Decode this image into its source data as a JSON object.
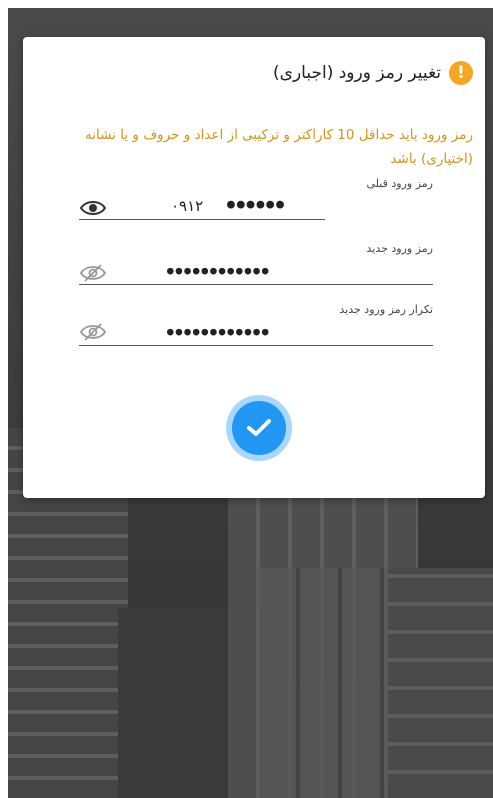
{
  "dialog": {
    "title": "تغییر رمز ورود  (اجباری)",
    "hint": "رمز ورود باید حداقل 10 کاراکتر و ترکیبی از اعداد و حروف و یا نشانه (اختیاری) باشد"
  },
  "fields": {
    "old_password": {
      "label": "رمز ورود قبلی",
      "prefix": "۰۹۱۲",
      "value": "●●●●●●"
    },
    "new_password": {
      "label": "رمز ورود جدید",
      "value": "●●●●●●●●●●●●"
    },
    "confirm_password": {
      "label": "تکرار رمز ورود جدید",
      "value": "●●●●●●●●●●●●"
    }
  },
  "icons": {
    "warning": "warning-icon",
    "eye_visible": "eye-icon",
    "eye_hidden": "eye-off-icon",
    "confirm": "checkmark-icon"
  },
  "colors": {
    "warning": "#f5a623",
    "hint": "#d4931a",
    "accent": "#2196f3"
  }
}
